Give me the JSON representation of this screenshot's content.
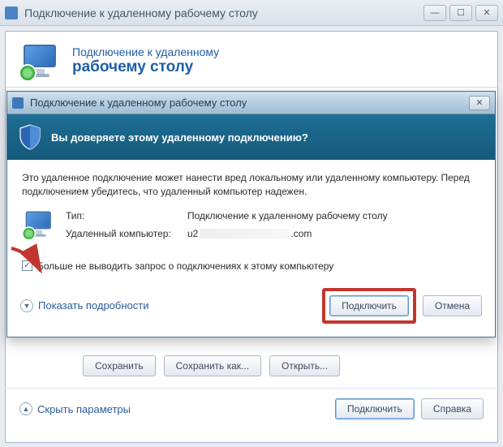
{
  "parent": {
    "title": "Подключение к удаленному рабочему столу",
    "header_line1": "Подключение к удаленному",
    "header_line2": "рабочему столу",
    "buttons": {
      "save": "Сохранить",
      "save_as": "Сохранить как...",
      "open": "Открыть..."
    },
    "hide_params": "Скрыть параметры",
    "connect": "Подключить",
    "help": "Справка"
  },
  "dialog": {
    "title": "Подключение к удаленному рабочему столу",
    "header_question": "Вы доверяете этому удаленному подключению?",
    "warning": "Это удаленное подключение может нанести вред локальному или удаленному компьютеру. Перед подключением убедитесь, что удаленный компьютер надежен.",
    "fields": {
      "type_label": "Тип:",
      "type_value": "Подключение к удаленному рабочему столу",
      "remote_label": "Удаленный компьютер:",
      "remote_prefix": "u2",
      "remote_suffix": ".com"
    },
    "checkbox_label": "Больше не выводить запрос о подключениях к этому компьютеру",
    "checkbox_checked": true,
    "show_details": "Показать подробности",
    "connect": "Подключить",
    "cancel": "Отмена"
  },
  "winbtns": {
    "min": "—",
    "max": "☐",
    "close": "✕"
  }
}
